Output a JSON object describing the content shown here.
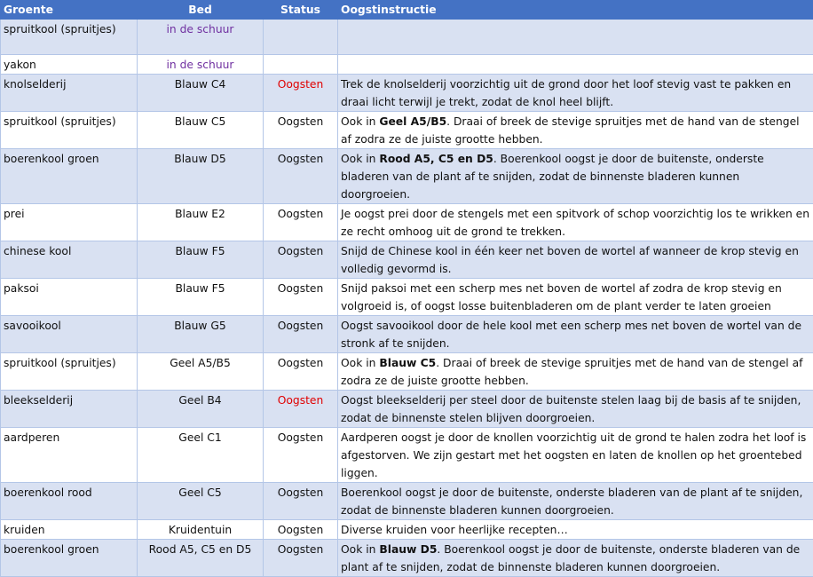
{
  "headers": [
    "Groente",
    "Bed",
    "Status",
    "Oogstinstructie"
  ],
  "rows": [
    {
      "groente": "spruitkool (spruitjes)",
      "bed": "in de schuur",
      "status": "",
      "pre": "",
      "bold": "",
      "post": ""
    },
    {
      "groente": "yakon",
      "bed": "in de schuur",
      "status": "",
      "pre": "",
      "bold": "",
      "post": ""
    },
    {
      "groente": "knolselderij",
      "bed": "Blauw C4",
      "status": "Oogsten",
      "pre": "Trek de knolselderij voorzichtig uit de grond door het loof stevig vast te pakken en draai licht terwijl je trekt, zodat de knol heel blijft.",
      "bold": "",
      "post": ""
    },
    {
      "groente": "spruitkool (spruitjes)",
      "bed": "Blauw C5",
      "status": "Oogsten",
      "pre": "Ook in ",
      "bold": "Geel A5/B5",
      "post": ". Draai of breek de stevige spruitjes met de hand van de stengel af zodra ze de juiste grootte hebben."
    },
    {
      "groente": "boerenkool groen",
      "bed": "Blauw D5",
      "status": "Oogsten",
      "pre": "Ook in ",
      "bold": "Rood A5, C5 en D5",
      "post": ". Boerenkool oogst je door de buitenste, onderste bladeren van de plant af te snijden, zodat de binnenste bladeren kunnen doorgroeien."
    },
    {
      "groente": "prei",
      "bed": "Blauw E2",
      "status": "Oogsten",
      "pre": "Je oogst prei door de stengels met een spitvork of schop voorzichtig los te wrikken en ze recht omhoog uit de grond te trekken.",
      "bold": "",
      "post": ""
    },
    {
      "groente": "chinese kool",
      "bed": "Blauw F5",
      "status": "Oogsten",
      "pre": "Snijd de Chinese kool in één keer net boven de wortel af wanneer de krop stevig en volledig gevormd is.",
      "bold": "",
      "post": ""
    },
    {
      "groente": "paksoi",
      "bed": "Blauw F5",
      "status": "Oogsten",
      "pre": "Snijd paksoi met een scherp mes net boven de wortel af zodra de krop stevig en volgroeid is, of oogst losse buitenbladeren om de plant verder te laten groeien",
      "bold": "",
      "post": ""
    },
    {
      "groente": "savooikool",
      "bed": "Blauw G5",
      "status": "Oogsten",
      "pre": "Oogst savooikool door de hele kool met een scherp mes net boven de wortel van de stronk af te snijden.",
      "bold": "",
      "post": ""
    },
    {
      "groente": "spruitkool (spruitjes)",
      "bed": "Geel A5/B5",
      "status": "Oogsten",
      "pre": "Ook in ",
      "bold": "Blauw C5",
      "post": ". Draai of breek de stevige spruitjes met de hand van de stengel af zodra ze de juiste grootte hebben."
    },
    {
      "groente": "bleekselderij",
      "bed": "Geel B4",
      "status": "Oogsten",
      "pre": "Oogst bleekselderij per steel door de buitenste stelen laag bij de basis af te snijden, zodat de binnenste stelen blijven doorgroeien.",
      "bold": "",
      "post": ""
    },
    {
      "groente": "aardperen",
      "bed": "Geel C1",
      "status": "Oogsten",
      "pre": "Aardperen oogst je door de knollen voorzichtig uit de grond te halen zodra het loof is afgestorven. We zijn gestart met het oogsten en laten de knollen op het groentebed liggen.",
      "bold": "",
      "post": ""
    },
    {
      "groente": "boerenkool rood",
      "bed": "Geel C5",
      "status": "Oogsten",
      "pre": "Boerenkool oogst je door de buitenste, onderste bladeren van de plant af te snijden, zodat de binnenste bladeren kunnen doorgroeien.",
      "bold": "",
      "post": ""
    },
    {
      "groente": "kruiden",
      "bed": "Kruidentuin",
      "status": "Oogsten",
      "pre": "Diverse kruiden voor heerlijke recepten…",
      "bold": "",
      "post": ""
    },
    {
      "groente": "boerenkool groen",
      "bed": "Rood A5, C5 en D5",
      "status": "Oogsten",
      "pre": "Ook in ",
      "bold": "Blauw D5",
      "post": ". Boerenkool oogst je door de buitenste, onderste bladeren van de plant af te snijden, zodat de binnenste bladeren kunnen doorgroeien."
    }
  ]
}
